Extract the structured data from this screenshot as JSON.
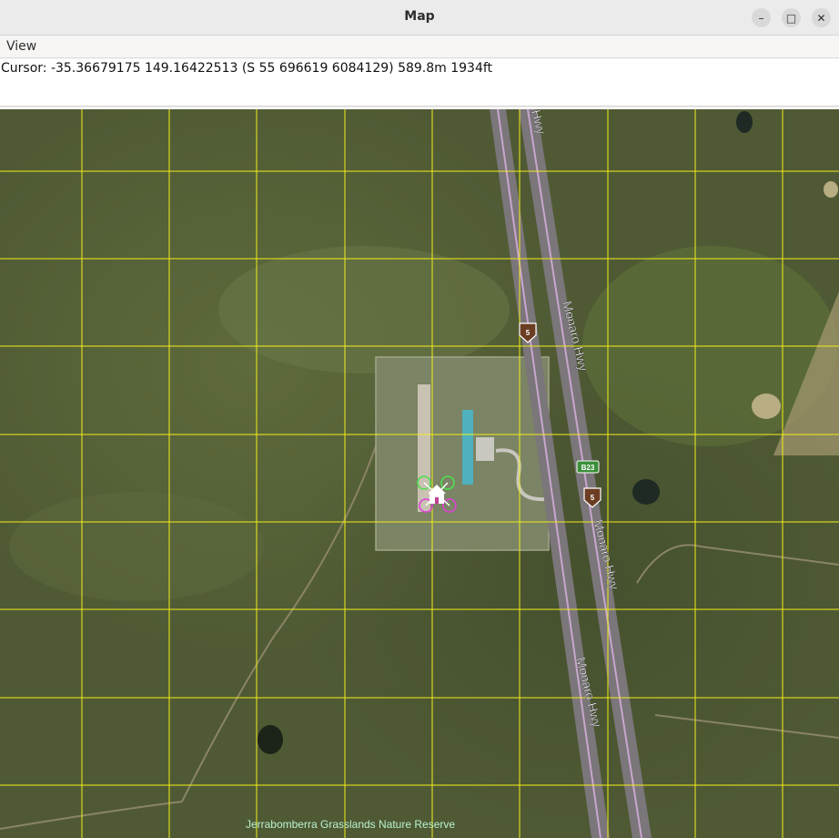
{
  "window": {
    "title": "Map",
    "controls": [
      "minimize-icon",
      "maximize-icon",
      "close-icon"
    ]
  },
  "menu": {
    "items": [
      "View"
    ]
  },
  "status": {
    "cursor_text": "Cursor: -35.36679175 149.16422513 (S 55 696619 6084129) 589.8m 1934ft"
  },
  "map": {
    "grid_color": "#f2ee1a",
    "road_labels": [
      "Hwy",
      "Monaro Hwy",
      "Monaro Hwy",
      "Monaro Hwy"
    ],
    "route_shields": [
      "5",
      "B23",
      "5"
    ],
    "place_label": "Jerrabomberra Grasslands Nature Reserve",
    "icons": [
      "vehicle-icon",
      "home-icon"
    ]
  }
}
